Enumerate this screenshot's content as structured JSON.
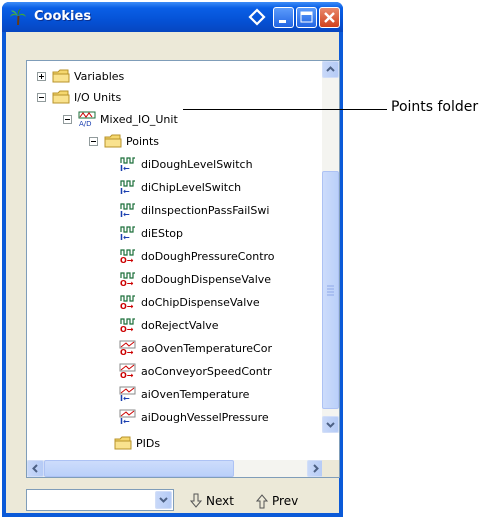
{
  "window": {
    "title": "Cookies"
  },
  "tree": {
    "items": [
      {
        "label": "Variables",
        "icon": "folder-icon",
        "expander": "plus"
      },
      {
        "label": "I/O Units",
        "icon": "folder-icon",
        "expander": "minus"
      },
      {
        "label": "Mixed_IO_Unit",
        "icon": "io-unit-icon",
        "expander": "minus"
      },
      {
        "label": "Points",
        "icon": "folder-icon",
        "expander": "minus"
      },
      {
        "label": "diDoughLevelSwitch",
        "icon": "digital-input-icon"
      },
      {
        "label": "diChipLevelSwitch",
        "icon": "digital-input-icon"
      },
      {
        "label": "diInspectionPassFailSwi",
        "icon": "digital-input-icon"
      },
      {
        "label": "diEStop",
        "icon": "digital-input-icon"
      },
      {
        "label": "doDoughPressureContro",
        "icon": "digital-output-icon"
      },
      {
        "label": "doDoughDispenseValve",
        "icon": "digital-output-icon"
      },
      {
        "label": "doChipDispenseValve",
        "icon": "digital-output-icon"
      },
      {
        "label": "doRejectValve",
        "icon": "digital-output-icon"
      },
      {
        "label": "aoOvenTemperatureCor",
        "icon": "analog-output-icon"
      },
      {
        "label": "aoConveyorSpeedContr",
        "icon": "analog-output-icon"
      },
      {
        "label": "aiOvenTemperature",
        "icon": "analog-input-icon"
      },
      {
        "label": "aiDoughVesselPressure",
        "icon": "analog-input-icon"
      },
      {
        "label": "PIDs",
        "icon": "folder-icon"
      }
    ]
  },
  "search": {
    "value": ""
  },
  "nav": {
    "next_label": "Next",
    "prev_label": "Prev"
  },
  "callout": {
    "label": "Points folder"
  },
  "colors": {
    "titlebar": "#0552d6",
    "folder": "#f5d76e",
    "window_bg": "#ece9d8"
  }
}
